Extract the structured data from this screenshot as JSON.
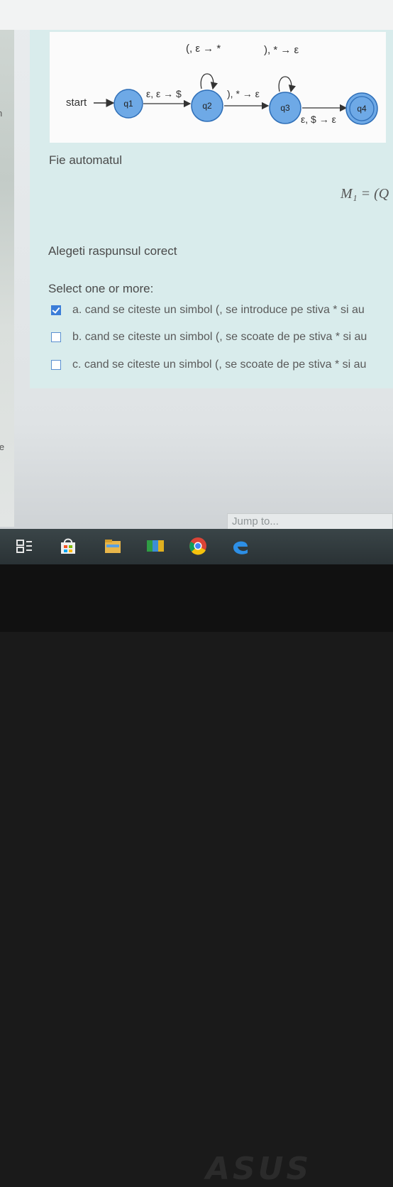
{
  "sidebar_hint_top": "n",
  "sidebar_hint_bottom": "ie",
  "diagram": {
    "start_label": "start",
    "states": [
      "q1",
      "q2",
      "q3",
      "q4"
    ],
    "transition_q1_q2": "ε, ε → $",
    "transition_q2_q3": "), * → ε",
    "transition_q3_q4": "ε, $ → ε",
    "loop_q2": "(, ε → *",
    "loop_q3": "), * → ε"
  },
  "question": {
    "intro": "Fie automatul",
    "formula": "M₁ = (Q",
    "prompt": "Alegeti raspunsul corect",
    "select_label": "Select one or more:",
    "options": [
      {
        "label": "a. cand se citeste un simbol (, se introduce pe stiva * si au",
        "checked": true
      },
      {
        "label": "b. cand se citeste un simbol (, se scoate de pe stiva * si au",
        "checked": false
      },
      {
        "label": "c. cand se citeste un simbol (, se scoate de pe stiva * si au",
        "checked": false
      }
    ]
  },
  "jump_placeholder": "Jump to...",
  "taskbar_icons": [
    "task-view-icon",
    "store-icon",
    "file-explorer-icon",
    "office-icon",
    "chrome-icon",
    "edge-icon"
  ],
  "brand": "ASUS",
  "colors": {
    "panel": "#d9ecec",
    "state_fill": "#6ea9e6",
    "checkbox_accent": "#3b7dd8"
  }
}
